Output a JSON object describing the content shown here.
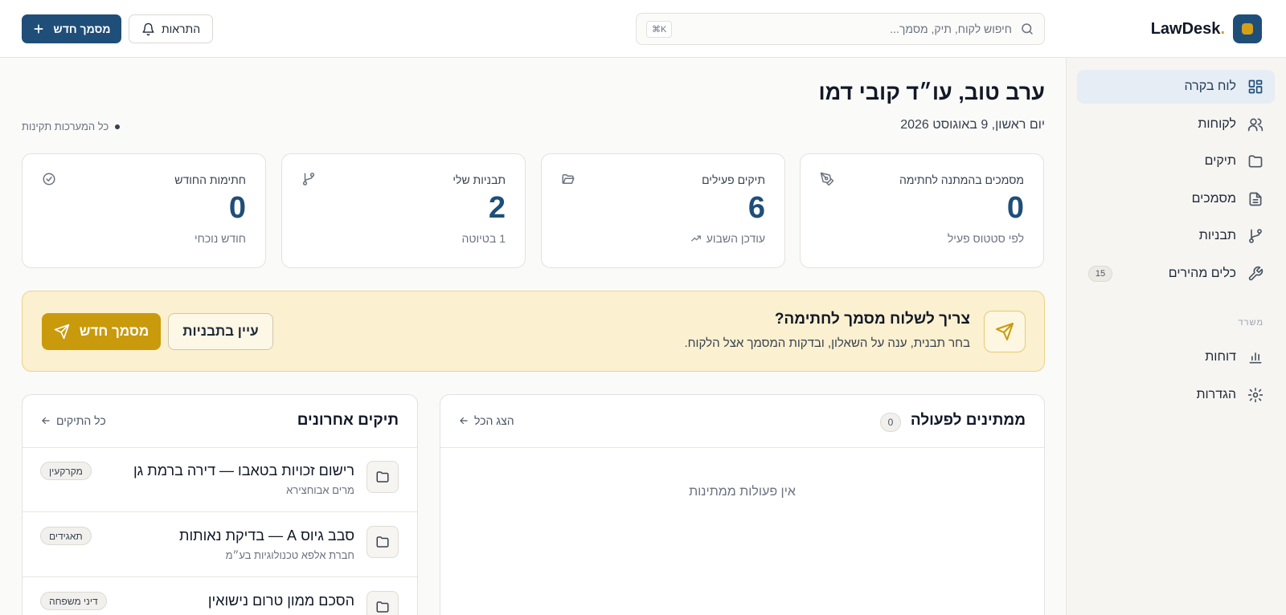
{
  "brand": {
    "name": "LawDesk",
    "dot": "."
  },
  "search": {
    "placeholder": "חיפוש לקוח, תיק, מסמך...",
    "shortcut": "⌘K"
  },
  "header": {
    "notifications_label": "התראות",
    "new_document_label": "מסמך חדש"
  },
  "sidebar": {
    "items": [
      {
        "label": "לוח בקרה",
        "icon": "dashboard-icon",
        "active": true
      },
      {
        "label": "לקוחות",
        "icon": "users-icon"
      },
      {
        "label": "תיקים",
        "icon": "folder-icon"
      },
      {
        "label": "מסמכים",
        "icon": "document-icon"
      },
      {
        "label": "תבניות",
        "icon": "git-branch-icon"
      },
      {
        "label": "כלים מהירים",
        "icon": "wrench-icon",
        "badge": "15"
      }
    ],
    "section_label": "משרד",
    "office_items": [
      {
        "label": "דוחות",
        "icon": "bar-chart-icon"
      },
      {
        "label": "הגדרות",
        "icon": "gear-icon"
      }
    ]
  },
  "greeting": "ערב טוב, עו״ד קובי דמו",
  "date": "יום ראשון, 9 באוגוסט 2026",
  "system_status": "כל המערכות תקינות",
  "stats": [
    {
      "label": "מסמכים בהמתנה לחתימה",
      "value": "0",
      "sub": "לפי סטטוס פעיל",
      "icon": "pen-icon"
    },
    {
      "label": "תיקים פעילים",
      "value": "6",
      "sub": "עודכן השבוע",
      "icon": "folder-open-icon"
    },
    {
      "label": "תבניות שלי",
      "value": "2",
      "sub": "1 בטיוטה",
      "icon": "git-branch-icon"
    },
    {
      "label": "חתימות החודש",
      "value": "0",
      "sub": "חודש נוכחי",
      "icon": "check-circle-icon"
    }
  ],
  "cta": {
    "title": "צריך לשלוח מסמך לחתימה?",
    "description": "בחר תבנית, ענה על השאלון, ובדקות המסמך אצל הלקוח.",
    "primary_label": "מסמך חדש",
    "secondary_label": "עיין בתבניות"
  },
  "pending": {
    "title": "ממתינים לפעולה",
    "count": "0",
    "link": "הצג הכל",
    "empty": "אין פעולות ממתינות"
  },
  "recent_cases": {
    "title": "תיקים אחרונים",
    "link": "כל התיקים",
    "items": [
      {
        "title": "רישום זכויות בטאבו — דירה ברמת גן",
        "client": "מרים אבוחצירא",
        "tag": "מקרקעין"
      },
      {
        "title": "סבב גיוס A — בדיקת נאותות",
        "client": "חברת אלפא טכנולוגיות בע״מ",
        "tag": "תאגידים"
      },
      {
        "title": "הסכם ממון טרום נישואין",
        "client": "",
        "tag": "דיני משפחה"
      }
    ]
  },
  "colors": {
    "primary": "#1f4e79",
    "accent": "#c99a0b",
    "cta_background": "#fbf0cf"
  }
}
